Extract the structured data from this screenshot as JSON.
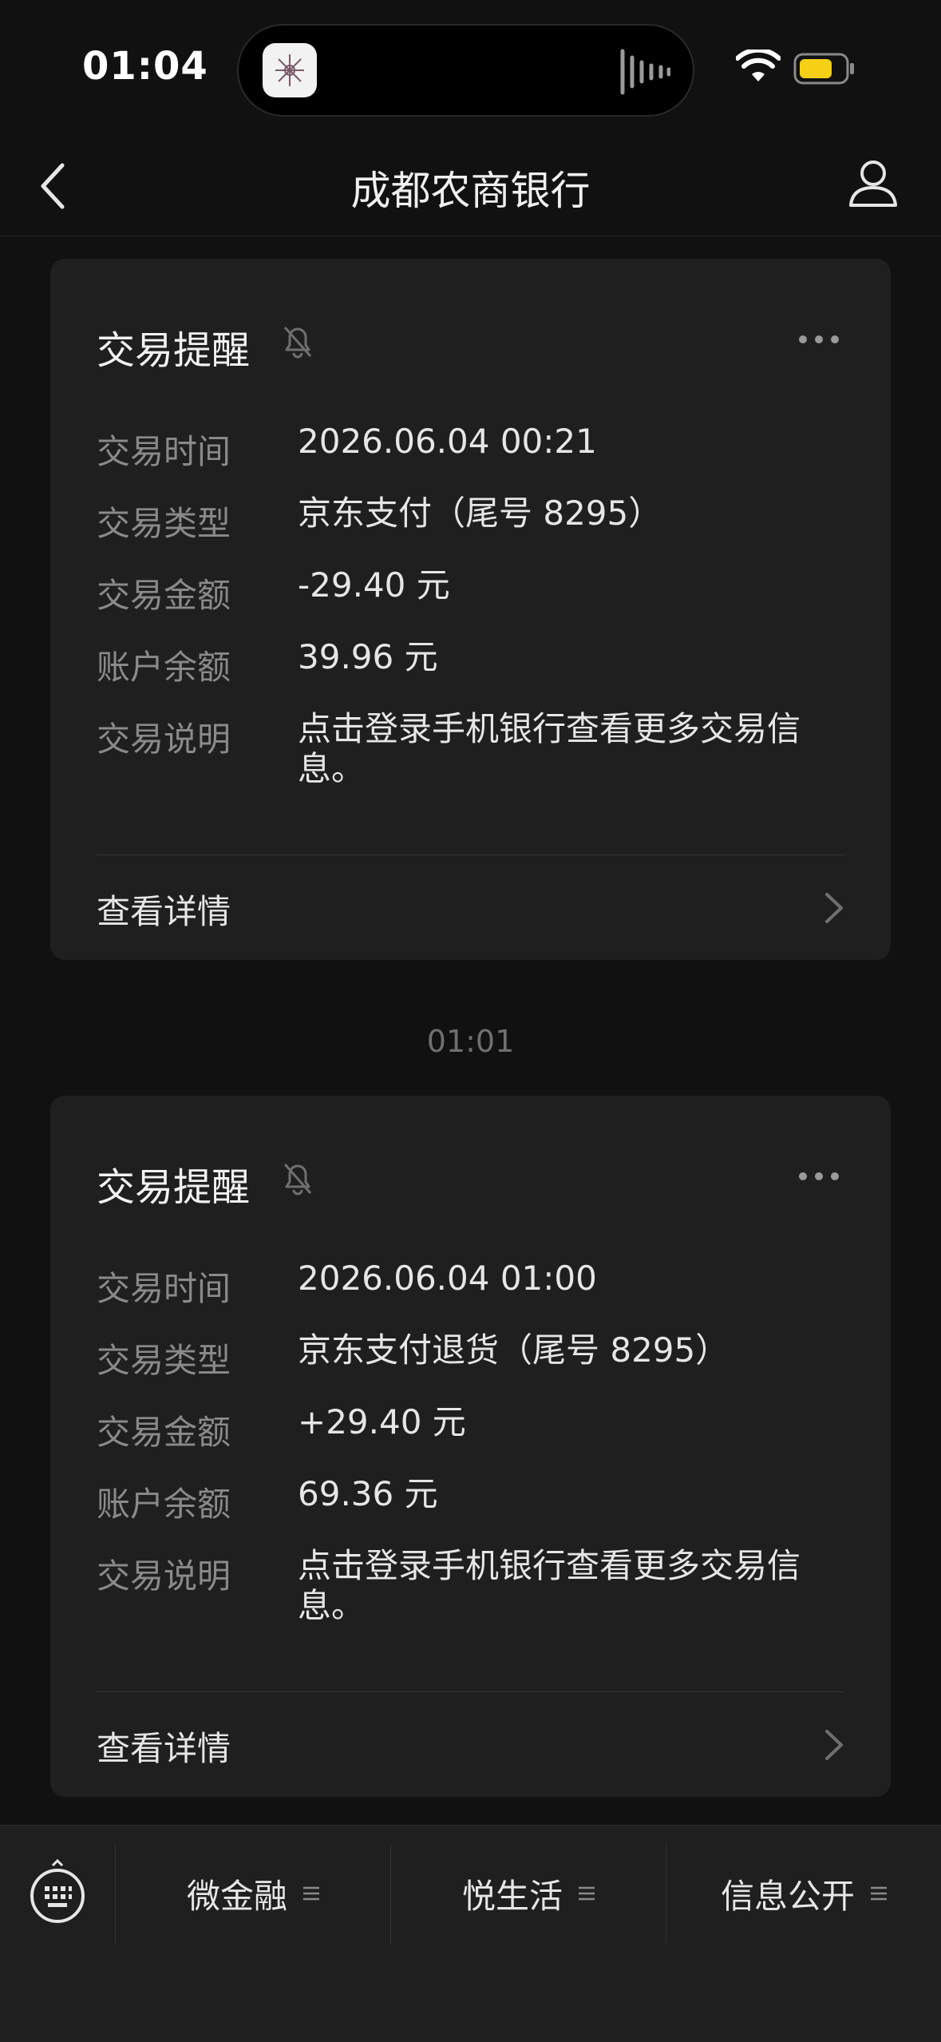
{
  "status_bar": {
    "time": "01:04"
  },
  "nav": {
    "title": "成都农商银行"
  },
  "cards": [
    {
      "title": "交易提醒",
      "rows": [
        {
          "label": "交易时间",
          "value": "2026.06.04 00:21"
        },
        {
          "label": "交易类型",
          "value": "京东支付（尾号 8295）"
        },
        {
          "label": "交易金额",
          "value": "-29.40 元"
        },
        {
          "label": "账户余额",
          "value": "39.96 元"
        },
        {
          "label": "交易说明",
          "value": "点击登录手机银行查看更多交易信息。"
        }
      ],
      "detail_label": "查看详情"
    },
    {
      "title": "交易提醒",
      "rows": [
        {
          "label": "交易时间",
          "value": "2026.06.04 01:00"
        },
        {
          "label": "交易类型",
          "value": "京东支付退货（尾号 8295）"
        },
        {
          "label": "交易金额",
          "value": "+29.40 元"
        },
        {
          "label": "账户余额",
          "value": "69.36 元"
        },
        {
          "label": "交易说明",
          "value": "点击登录手机银行查看更多交易信息。"
        }
      ],
      "detail_label": "查看详情"
    }
  ],
  "timestamp_divider": "01:01",
  "bottom_menu": [
    {
      "label": "微金融"
    },
    {
      "label": "悦生活"
    },
    {
      "label": "信息公开"
    }
  ],
  "colors": {
    "background": "#111111",
    "card": "#1f1f1f",
    "label": "#8a8a8a",
    "value": "#e6e6e6",
    "battery": "#f5d014"
  }
}
